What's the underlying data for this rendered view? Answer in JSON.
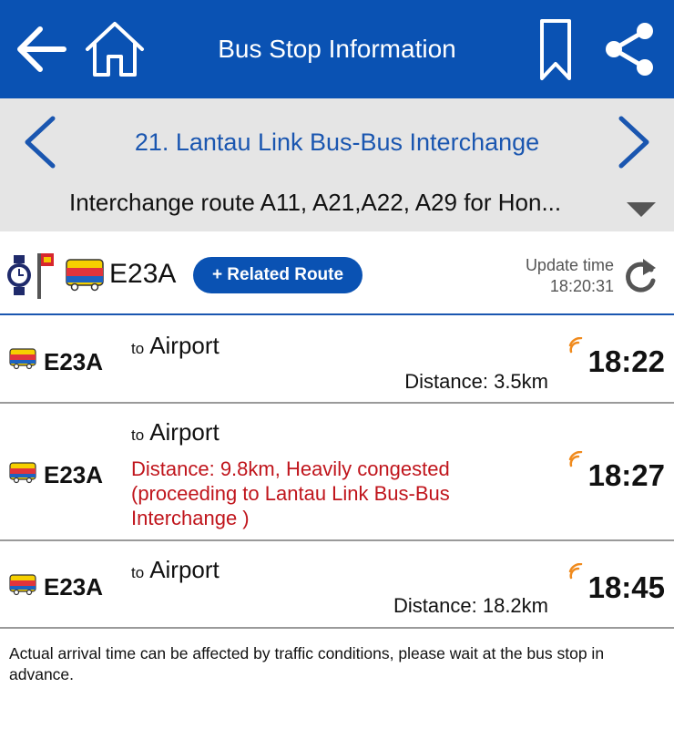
{
  "header": {
    "title": "Bus Stop Information"
  },
  "stop": {
    "name": "21. Lantau Link Bus-Bus Interchange",
    "route_selector": "Interchange route A11, A21,A22, A29 for Hon..."
  },
  "route_header": {
    "route": "E23A",
    "related_button": "+ Related Route",
    "update_label": "Update time",
    "update_time": "18:20:31"
  },
  "arrivals": [
    {
      "route": "E23A",
      "to_prefix": "to",
      "destination": "Airport",
      "distance": "Distance: 3.5km",
      "eta": "18:22"
    },
    {
      "route": "E23A",
      "to_prefix": "to",
      "destination": "Airport",
      "status": "Distance: 9.8km, Heavily congested (proceeding to Lantau Link Bus-Bus Interchange )",
      "eta": "18:27"
    },
    {
      "route": "E23A",
      "to_prefix": "to",
      "destination": "Airport",
      "distance": "Distance: 18.2km",
      "eta": "18:45"
    }
  ],
  "footer": {
    "note": "Actual arrival time can be affected by traffic conditions, please wait at the bus stop in advance."
  },
  "colors": {
    "primary": "#0a52b3",
    "link": "#1a56b0",
    "alert": "#c0151c",
    "signal": "#f08a1c"
  }
}
